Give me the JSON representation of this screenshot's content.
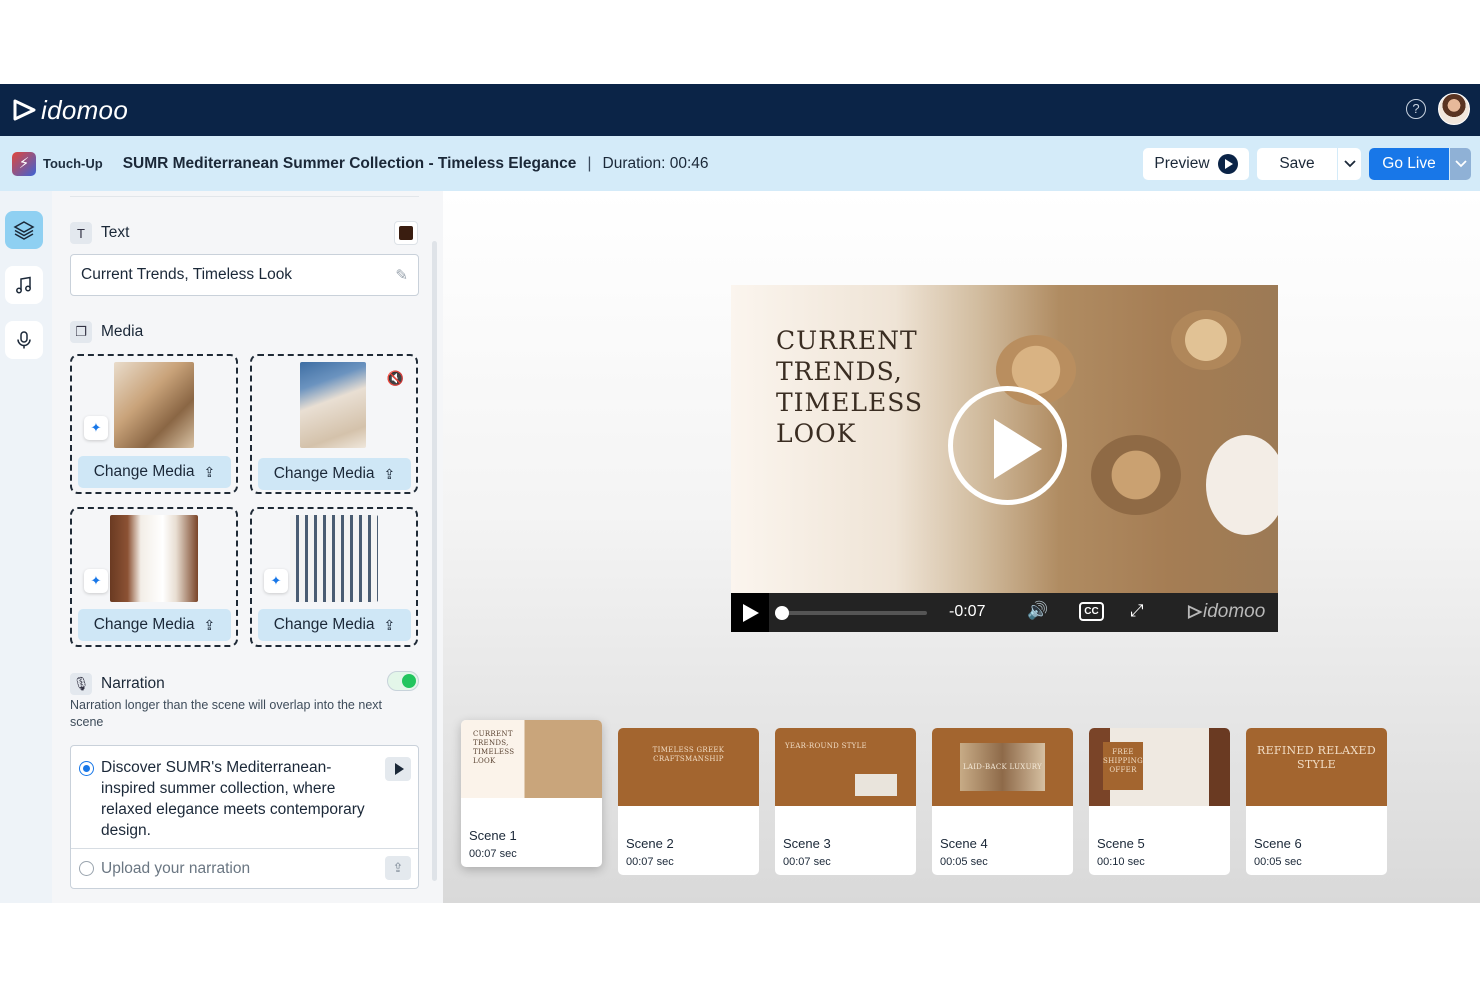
{
  "app": {
    "brand": "idomoo"
  },
  "project": {
    "mode_label": "Touch-Up",
    "title": "SUMR Mediterranean Summer Collection - Timeless Elegance",
    "separator": "|",
    "duration": "Duration: 00:46"
  },
  "toolbar": {
    "preview_label": "Preview",
    "save_label": "Save",
    "golive_label": "Go Live"
  },
  "panel": {
    "text_section": {
      "heading": "Text",
      "value": "Current Trends, Timeless Look",
      "swatch_color": "#3a1d10"
    },
    "media_section": {
      "heading": "Media",
      "tiles": [
        {
          "button_label": "Change Media"
        },
        {
          "button_label": "Change Media"
        },
        {
          "button_label": "Change Media"
        },
        {
          "button_label": "Change Media"
        }
      ]
    },
    "narration": {
      "heading": "Narration",
      "enabled": true,
      "note": "Narration longer than the scene will overlap into the next scene",
      "script": "Discover SUMR's Mediterranean-inspired summer collection, where relaxed elegance meets contemporary design.",
      "upload_label": "Upload your narration"
    }
  },
  "player": {
    "title_lines": [
      "CURRENT",
      "TRENDS,",
      "TIMELESS",
      "LOOK"
    ],
    "time_remaining": "-0:07",
    "progress": 0.02,
    "cc_label": "CC",
    "watermark": "idomoo"
  },
  "scenes": [
    {
      "name": "Scene 1",
      "duration": "00:07 sec",
      "caption": [
        "CURRENT",
        "TRENDS,",
        "TIMELESS",
        "LOOK"
      ],
      "active": true
    },
    {
      "name": "Scene 2",
      "duration": "00:07 sec",
      "caption": [
        "TIMELESS GREEK",
        "CRAFTSMANSHIP"
      ],
      "active": false
    },
    {
      "name": "Scene 3",
      "duration": "00:07 sec",
      "caption": [
        "YEAR-ROUND STYLE"
      ],
      "active": false
    },
    {
      "name": "Scene 4",
      "duration": "00:05 sec",
      "caption": [
        "LAID-BACK LUXURY"
      ],
      "active": false
    },
    {
      "name": "Scene 5",
      "duration": "00:10 sec",
      "caption": [
        "FREE",
        "SHIPPING",
        "OFFER"
      ],
      "active": false
    },
    {
      "name": "Scene 6",
      "duration": "00:05 sec",
      "caption": [
        "REFINED RELAXED",
        "STYLE"
      ],
      "active": false
    }
  ],
  "colors": {
    "navy": "#0b2447",
    "accent_blue": "#1877e8",
    "scene_brown": "#a3652f",
    "toggle_on": "#22c55e"
  }
}
